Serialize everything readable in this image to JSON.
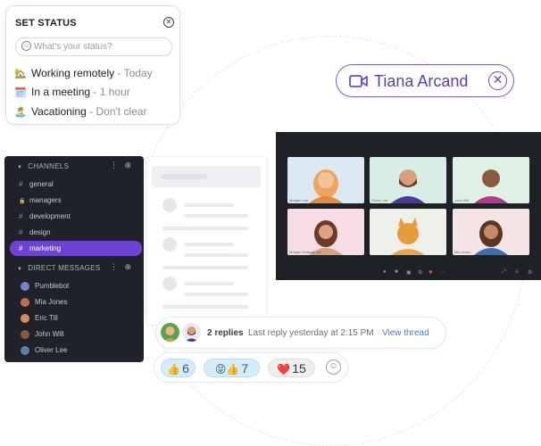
{
  "status": {
    "title": "SET STATUS",
    "placeholder": "What's your status?",
    "options": [
      {
        "emoji": "🏡",
        "label": "Working remotely",
        "sub": " - Today"
      },
      {
        "emoji": "🗓️",
        "label": "In a meeting",
        "sub": " - 1 hour"
      },
      {
        "emoji": "🏝️",
        "label": "Vacationing",
        "sub": " - Don't clear"
      }
    ]
  },
  "call": {
    "name": "Tiana Arcand"
  },
  "sidebar": {
    "channels_label": "CHANNELS",
    "channels": [
      {
        "icon": "#",
        "label": "general"
      },
      {
        "icon": "🔒",
        "label": "managers"
      },
      {
        "icon": "#",
        "label": "development"
      },
      {
        "icon": "#",
        "label": "design"
      },
      {
        "icon": "#",
        "label": "marketing"
      }
    ],
    "dm_label": "DIRECT MESSAGES",
    "dms": [
      {
        "label": "Pumblebot",
        "color": "#7b7fd6"
      },
      {
        "label": "Mia Jones",
        "color": "#c46b4c"
      },
      {
        "label": "Eric Till",
        "color": "#d98a5a"
      },
      {
        "label": "John Will",
        "color": "#8a5a3c"
      },
      {
        "label": "Oliver Lee",
        "color": "#5d7fb0"
      }
    ]
  },
  "video": {
    "tiles": [
      {
        "bg": "#dbe9f4",
        "label": "Morgan Lee"
      },
      {
        "bg": "#d7eee7",
        "label": "Oliver Lee"
      },
      {
        "bg": "#dff0e4",
        "label": "John Will"
      },
      {
        "bg": "#f6dde3",
        "label": "Morgan Holland-Lee"
      },
      {
        "bg": "#eef0ea",
        "label": ""
      },
      {
        "bg": "#f5e4e6",
        "label": "Mia Jones"
      }
    ]
  },
  "thread": {
    "replies": "2 replies",
    "last_reply": "Last reply yesterday at 2:15 PM",
    "view": "View thread"
  },
  "reactions": [
    {
      "emoji": "👍",
      "count": "6"
    },
    {
      "emoji": "😝👍",
      "count": "7"
    },
    {
      "emoji": "❤️",
      "count": "15"
    }
  ],
  "colors": {
    "accent": "#6d43d4",
    "call_border": "#7a5cc9",
    "link": "#3d7fd8"
  }
}
